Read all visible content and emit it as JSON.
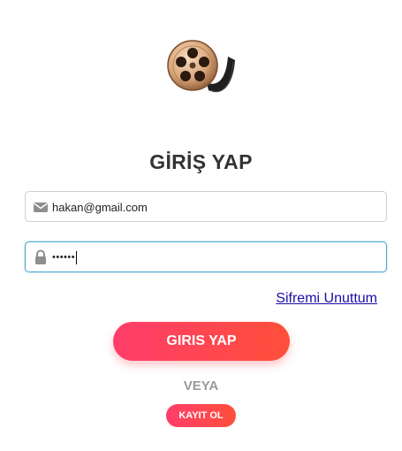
{
  "logo": {
    "icon": "film-reel-icon"
  },
  "title": "GİRİŞ YAP",
  "email_field": {
    "icon": "envelope-icon",
    "value": "hakan@gmail.com"
  },
  "password_field": {
    "icon": "lock-icon",
    "value": "••••••"
  },
  "forgot_link": "Sifremi Unuttum",
  "login_button": "GIRIS YAP",
  "or_text": "VEYA",
  "signup_button": "KAYIT OL",
  "colors": {
    "accent_start": "#ff3d6b",
    "accent_end": "#ff4f3a",
    "link": "#1a0dab",
    "focus_border": "#4fa5cf"
  }
}
